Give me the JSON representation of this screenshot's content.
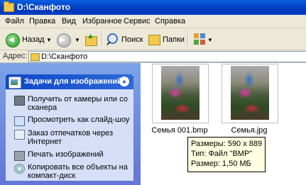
{
  "window": {
    "title": "D:\\Сканфото"
  },
  "menu": [
    "Файл",
    "Правка",
    "Вид",
    "Избранное",
    "Сервис",
    "Справка"
  ],
  "toolbar": {
    "back_label": "Назад",
    "search_label": "Поиск",
    "folders_label": "Папки"
  },
  "address": {
    "label": "Адрес:",
    "value": "D:\\Сканфото"
  },
  "tasks": {
    "header": "Задачи для изображений",
    "items": [
      {
        "label": "Получить от камеры или со сканера",
        "icon": "camera-icon"
      },
      {
        "label": "Просмотреть как слайд-шоу",
        "icon": "slideshow-icon"
      },
      {
        "label": "Заказ отпечатков через Интернет",
        "icon": "print-order-icon"
      },
      {
        "label": "Печать изображений",
        "icon": "printer-icon"
      },
      {
        "label": "Копировать все объекты на компакт-диск",
        "icon": "cd-icon"
      }
    ]
  },
  "files": [
    {
      "name": "Семья 001.bmp"
    },
    {
      "name": "Семья.jpg"
    }
  ],
  "tooltip": {
    "size": "Размеры: 590 x 889",
    "type": "Тип: Файл \"BMP\"",
    "filesize": "Размер: 1,50 МБ"
  }
}
